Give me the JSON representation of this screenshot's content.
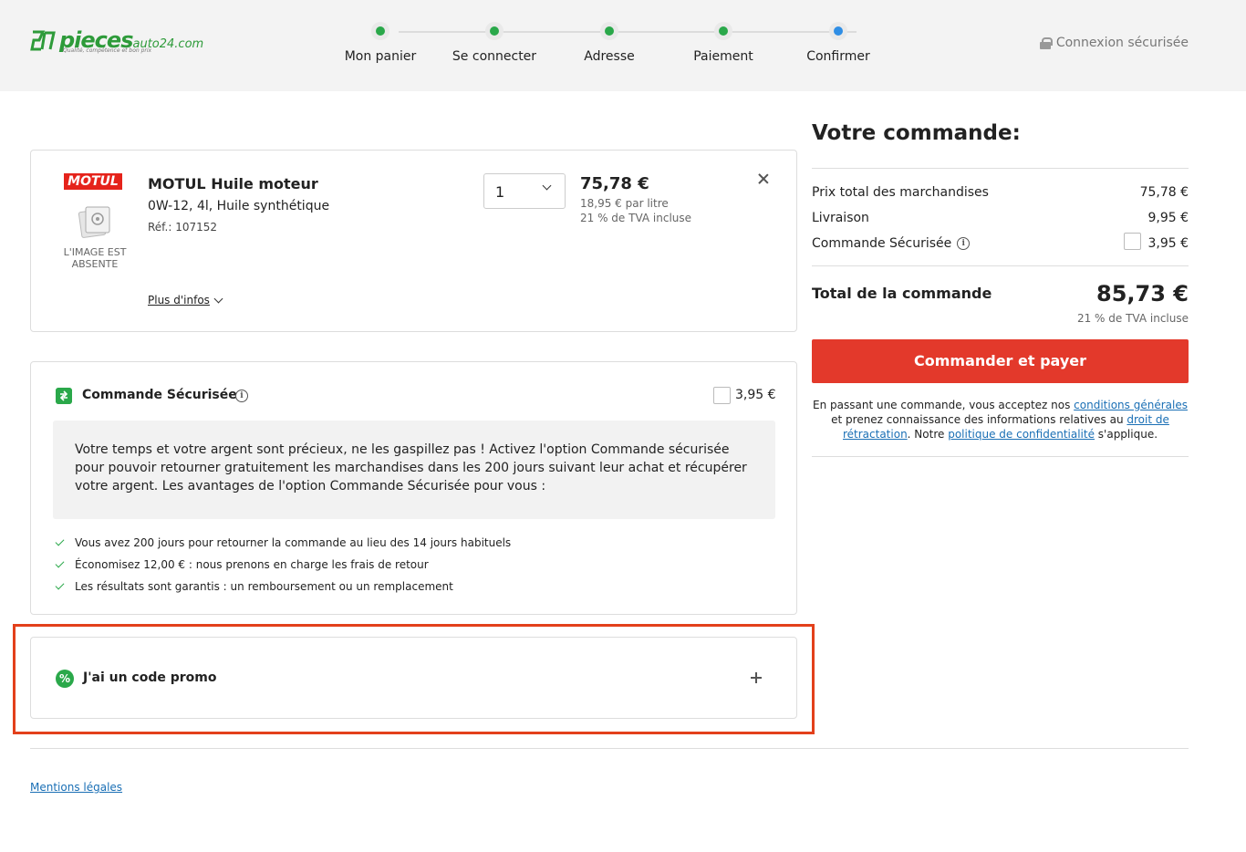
{
  "header": {
    "logo_text": "pieces",
    "logo_sub": "auto24.com",
    "logo_tagline": "Qualité, compétence et bon prix",
    "secure_connection": "Connexion sécurisée",
    "steps": [
      {
        "label": "Mon panier",
        "status": "done"
      },
      {
        "label": "Se connecter",
        "status": "done"
      },
      {
        "label": "Adresse",
        "status": "done"
      },
      {
        "label": "Paiement",
        "status": "done"
      },
      {
        "label": "Confirmer",
        "status": "current"
      }
    ]
  },
  "colors": {
    "done": "#2aa84a",
    "current": "#2f8ee5",
    "accent": "#e3392b",
    "link": "#1a6fb5"
  },
  "product": {
    "brand": "MOTUL",
    "no_image_label": "L'IMAGE EST ABSENTE",
    "name": "MOTUL Huile moteur",
    "description": "0W-12, 4l, Huile synthétique",
    "ref": "Réf.: 107152",
    "more_info": "Plus d'infos",
    "quantity": "1",
    "price": "75,78 €",
    "unit_price": "18,95 € par litre",
    "vat": "21 % de TVA incluse"
  },
  "secure_order": {
    "title": "Commande Sécurisée",
    "price": "3,95 €",
    "description": "Votre temps et votre argent sont précieux, ne les gaspillez pas ! Activez l'option Commande sécurisée pour pouvoir retourner gratuitement les marchandises dans les 200 jours suivant leur achat et récupérer votre argent. Les avantages de l'option Commande Sécurisée pour vous :",
    "benefits": [
      "Vous avez 200 jours pour retourner la commande au lieu des 14 jours habituels",
      "Économisez 12,00 € : nous prenons en charge les frais de retour",
      "Les résultats sont garantis : un remboursement ou un remplacement"
    ]
  },
  "promo": {
    "label": "J'ai un code promo",
    "icon_glyph": "%"
  },
  "footer": {
    "mentions": "Mentions légales"
  },
  "summary": {
    "title": "Votre commande:",
    "rows": [
      {
        "label": "Prix total des marchandises",
        "value": "75,78 €"
      },
      {
        "label": "Livraison",
        "value": "9,95 €"
      },
      {
        "label": "Commande Sécurisée",
        "value": "3,95 €"
      }
    ],
    "total_label": "Total de la commande",
    "total_value": "85,73 €",
    "total_vat": "21 % de TVA incluse",
    "order_button": "Commander et payer",
    "legal": {
      "part1": "En passant une commande, vous acceptez nos ",
      "link1": "conditions générales",
      "part2": " et prenez connaissance des informations relatives au ",
      "link2": "droit de rétractation",
      "part3": ". Notre ",
      "link3": "politique de confidentialité",
      "part4": " s'applique."
    }
  }
}
